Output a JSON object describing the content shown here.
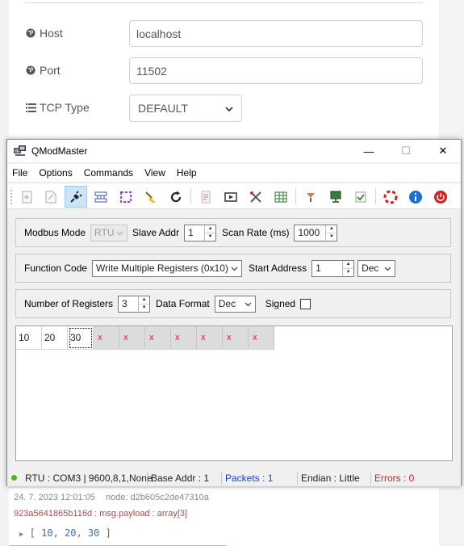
{
  "background": {
    "host_label": "Host",
    "host_value": "localhost",
    "port_label": "Port",
    "port_value": "11502",
    "tcp_type_label": "TCP Type",
    "tcp_type_value": "DEFAULT",
    "debug": {
      "timestamp": "24. 7. 2023 12:01:05",
      "node": "node: d2b605c2de47310a",
      "topic": "923a5641865b116d : msg.payload : array[3]",
      "payload": [
        "10",
        "20",
        "30"
      ]
    }
  },
  "window": {
    "title": "QModMaster",
    "controls": {
      "minimize": "—",
      "maximize": "☐",
      "close": "✕"
    },
    "menu": [
      "File",
      "Options",
      "Commands",
      "View",
      "Help"
    ],
    "toolbar_icons": [
      "connect-icon",
      "disconnect-icon",
      "plug-icon",
      "network-icon",
      "bus-monitor-icon",
      "clear-icon",
      "refresh-icon",
      "log-icon",
      "scan-icon",
      "tools-icon",
      "table-icon",
      "settings-icon",
      "serial-icon",
      "check-icon",
      "help-icon",
      "info-icon",
      "exit-icon"
    ]
  },
  "row1": {
    "modbus_mode_label": "Modbus Mode",
    "modbus_mode_value": "RTU",
    "slave_addr_label": "Slave Addr",
    "slave_addr_value": "1",
    "scan_rate_label": "Scan Rate (ms)",
    "scan_rate_value": "1000"
  },
  "row2": {
    "function_code_label": "Function Code",
    "function_code_value": "Write Multiple Registers (0x10)",
    "start_address_label": "Start Address",
    "start_address_value": "1",
    "address_format": "Dec"
  },
  "row3": {
    "num_registers_label": "Number of Registers",
    "num_registers_value": "3",
    "data_format_label": "Data Format",
    "data_format_value": "Dec",
    "signed_label": "Signed",
    "signed_checked": false
  },
  "registers": {
    "values": [
      "10",
      "20",
      "30"
    ],
    "placeholders": [
      "x",
      "x",
      "x",
      "x",
      "x",
      "x",
      "x"
    ]
  },
  "status": {
    "connection": "RTU : COM3 | 9600,8,1,None",
    "base_addr": "Base Addr : 1",
    "packets": "Packets : 1",
    "endian": "Endian : Little",
    "errors": "Errors : 0",
    "colors": {
      "packets": "#1a3fd6",
      "errors": "#d02020",
      "led": "#4cb21d"
    }
  }
}
